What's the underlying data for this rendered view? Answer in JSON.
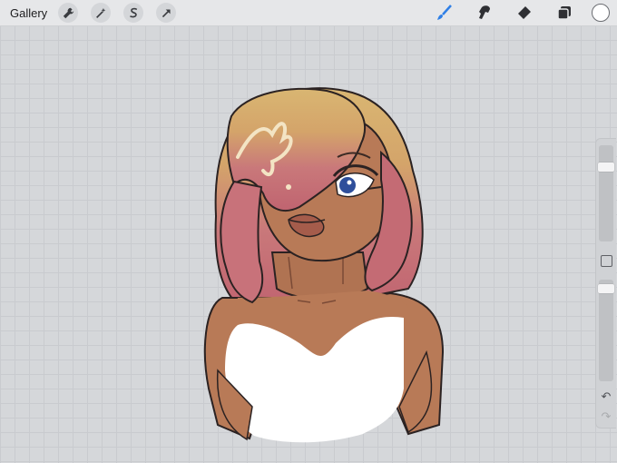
{
  "topbar": {
    "gallery_label": "Gallery",
    "left_tools": [
      "wrench-icon",
      "magic-wand-icon",
      "selection-s-icon",
      "arrow-transform-icon"
    ],
    "right_tools": [
      "brush-icon",
      "smudge-icon",
      "eraser-icon",
      "layers-icon"
    ],
    "active_tool": "brush",
    "current_color": "#ffffff"
  },
  "sidebar": {
    "brush_size": 0.8,
    "opacity": 0.95
  },
  "colors": {
    "accent": "#2f7fe6",
    "skin": "#b87a57",
    "hair_top": "#d9b672",
    "hair_bottom": "#c46b74",
    "eye": "#2f4f9b",
    "dress": "#ffffff"
  }
}
